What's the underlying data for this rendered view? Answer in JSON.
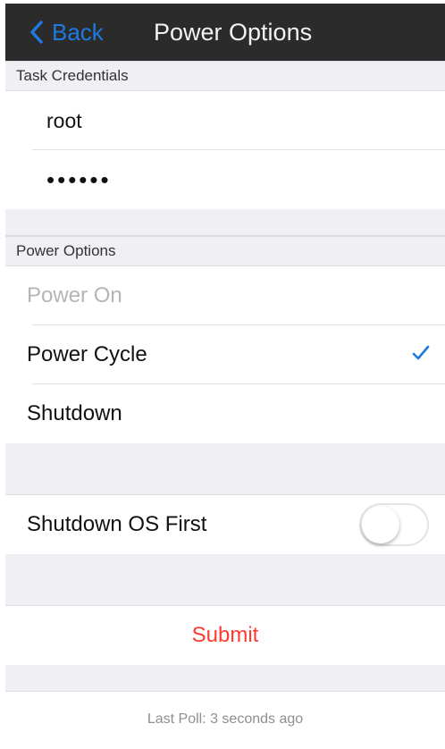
{
  "navbar": {
    "back_label": "Back",
    "title": "Power Options",
    "accent": "#1f7ae0",
    "background": "#2b2b2b"
  },
  "credentials": {
    "header": "Task Credentials",
    "username": "root",
    "password_mask": "••••••"
  },
  "power_options": {
    "header": "Power Options",
    "items": [
      {
        "label": "Power On",
        "disabled": true,
        "selected": false
      },
      {
        "label": "Power Cycle",
        "disabled": false,
        "selected": true
      },
      {
        "label": "Shutdown",
        "disabled": false,
        "selected": false
      }
    ]
  },
  "shutdown_os_first": {
    "label": "Shutdown OS First",
    "enabled": false
  },
  "submit": {
    "label": "Submit",
    "color": "#ff3b30"
  },
  "footer": {
    "last_poll": "Last Poll: 3 seconds ago"
  }
}
